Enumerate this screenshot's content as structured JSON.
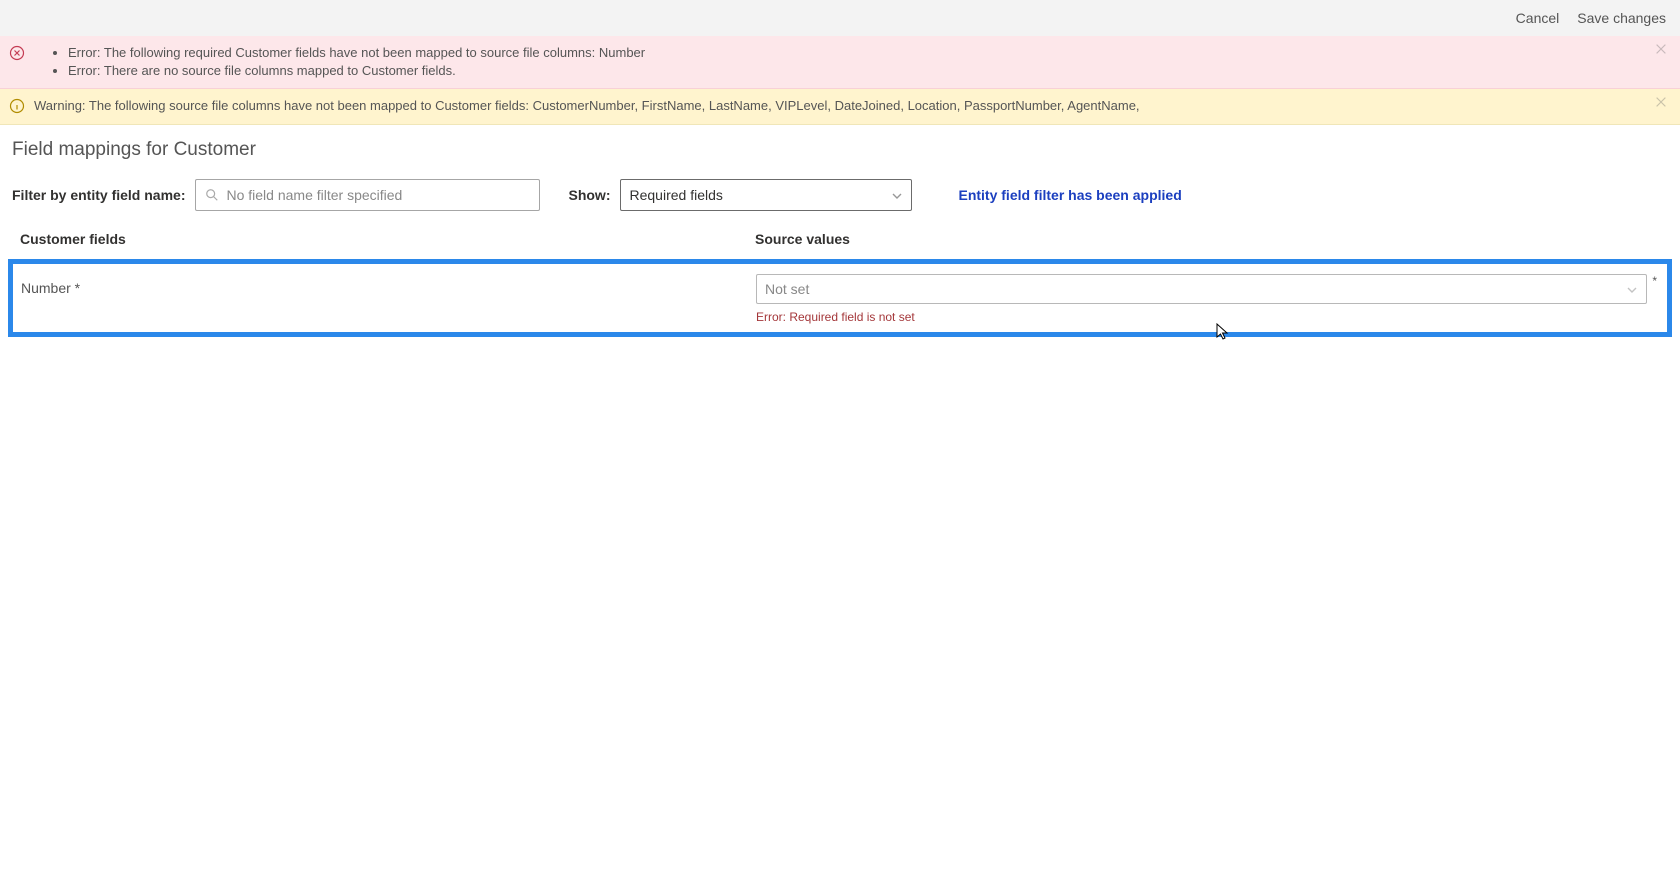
{
  "topbar": {
    "cancel": "Cancel",
    "save": "Save changes"
  },
  "banners": {
    "error_items": [
      "Error: The following required Customer fields have not been mapped to source file columns: Number",
      "Error: There are no source file columns mapped to Customer fields."
    ],
    "warning_text": "Warning: The following source file columns have not been mapped to Customer fields: CustomerNumber, FirstName, LastName, VIPLevel, DateJoined, Location, PassportNumber, AgentName,"
  },
  "page": {
    "title": "Field mappings for Customer"
  },
  "filter": {
    "label": "Filter by entity field name:",
    "placeholder": "No field name filter specified",
    "show_label": "Show:",
    "show_value": "Required fields",
    "applied_msg": "Entity field filter has been applied"
  },
  "columns": {
    "customer": "Customer fields",
    "source": "Source values"
  },
  "row": {
    "field_name": "Number *",
    "source_placeholder": "Not set",
    "required_mark": "*",
    "error": "Error: Required field is not set"
  }
}
